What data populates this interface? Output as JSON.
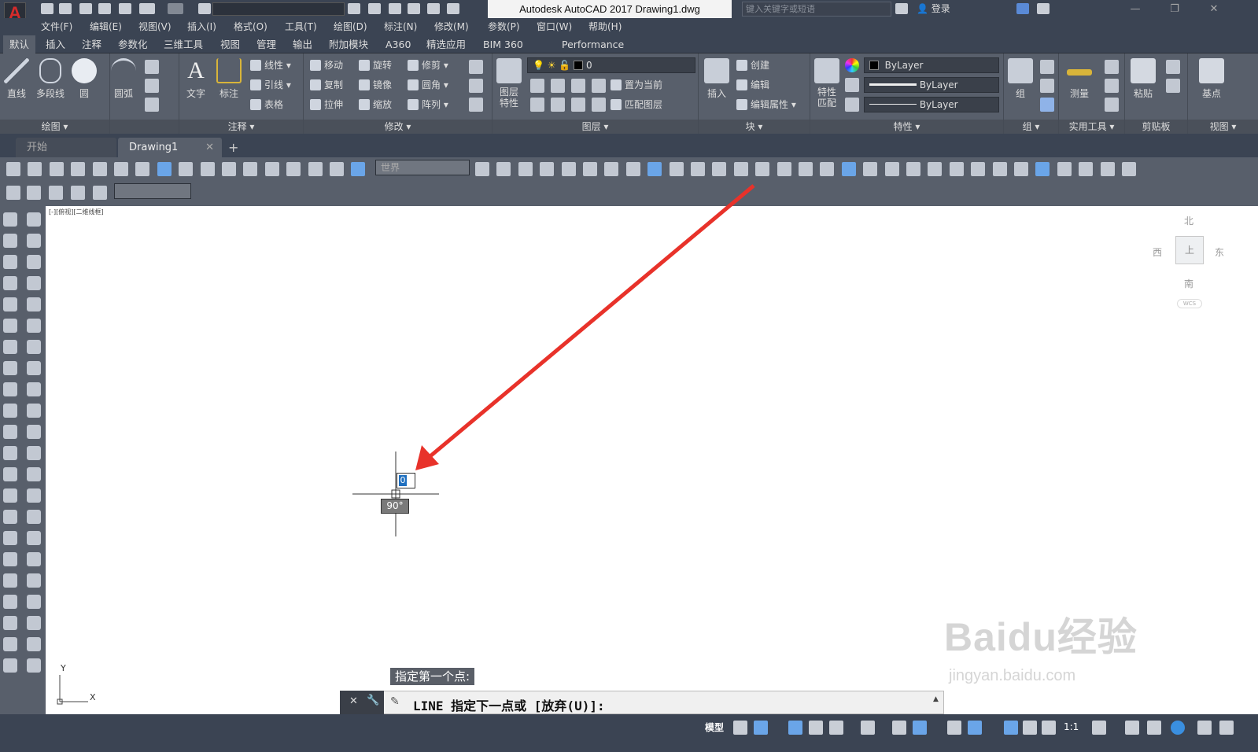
{
  "app": {
    "title": "Autodesk AutoCAD 2017    Drawing1.dwg",
    "logo_letter": "A",
    "workspace": "",
    "search_placeholder": "键入关键字或短语",
    "login": "登录"
  },
  "menu": [
    "文件(F)",
    "编辑(E)",
    "视图(V)",
    "插入(I)",
    "格式(O)",
    "工具(T)",
    "绘图(D)",
    "标注(N)",
    "修改(M)",
    "参数(P)",
    "窗口(W)",
    "帮助(H)"
  ],
  "ribbon_tabs": [
    "默认",
    "插入",
    "注释",
    "参数化",
    "三维工具",
    "视图",
    "管理",
    "输出",
    "附加模块",
    "A360",
    "精选应用",
    "BIM 360",
    "Performance"
  ],
  "ribbon": {
    "draw": {
      "footer": "绘图",
      "buttons": [
        "直线",
        "多段线",
        "圆",
        "圆弧"
      ]
    },
    "annotate": {
      "footer": "注释",
      "big": [
        "文字",
        "标注"
      ],
      "small": [
        "线性",
        "引线",
        "表格"
      ]
    },
    "modify": {
      "footer": "修改",
      "small": [
        "移动",
        "旋转",
        "修剪",
        "复制",
        "镜像",
        "圆角",
        "拉伸",
        "缩放",
        "阵列"
      ]
    },
    "layers": {
      "footer": "图层",
      "big": "图层特性",
      "layer_value": "0",
      "small": [
        "置为当前",
        "匹配图层"
      ]
    },
    "block": {
      "footer": "块",
      "big": "插入",
      "small": [
        "创建",
        "编辑",
        "编辑属性"
      ]
    },
    "properties": {
      "footer": "特性",
      "big": "特性匹配",
      "combos": [
        "ByLayer",
        "ByLayer",
        "ByLayer"
      ]
    },
    "group": {
      "footer": "组",
      "big": "组"
    },
    "utilities": {
      "footer": "实用工具",
      "big": "测量"
    },
    "clipboard": {
      "footer": "剪贴板",
      "big": "粘贴"
    },
    "view": {
      "footer": "视图",
      "big": "基点"
    }
  },
  "doc_tabs": [
    "开始",
    "Drawing1"
  ],
  "toolbar": {
    "ucs_combo": "世界",
    "empty_combo": ""
  },
  "viewport": {
    "label": "[-][俯视][二维线框]",
    "north": "北",
    "south": "南",
    "east": "东",
    "west": "西",
    "cube_face": "上",
    "wcs": "WCS"
  },
  "cursor": {
    "input_value": "0",
    "angle": "90°"
  },
  "command": {
    "prompt": "指定第一个点:",
    "line": "LINE 指定下一点或 [放弃(U)]: "
  },
  "ucs": {
    "x": "X",
    "y": "Y"
  },
  "status": {
    "model": "模型",
    "scale": "1:1"
  },
  "watermark": {
    "main": "Baidu经验",
    "sub": "jingyan.baidu.com"
  },
  "colors": {
    "annotation_arrow": "#e8322a",
    "ribbon_bg": "#585f6b",
    "title_bg": "#3b4453"
  }
}
